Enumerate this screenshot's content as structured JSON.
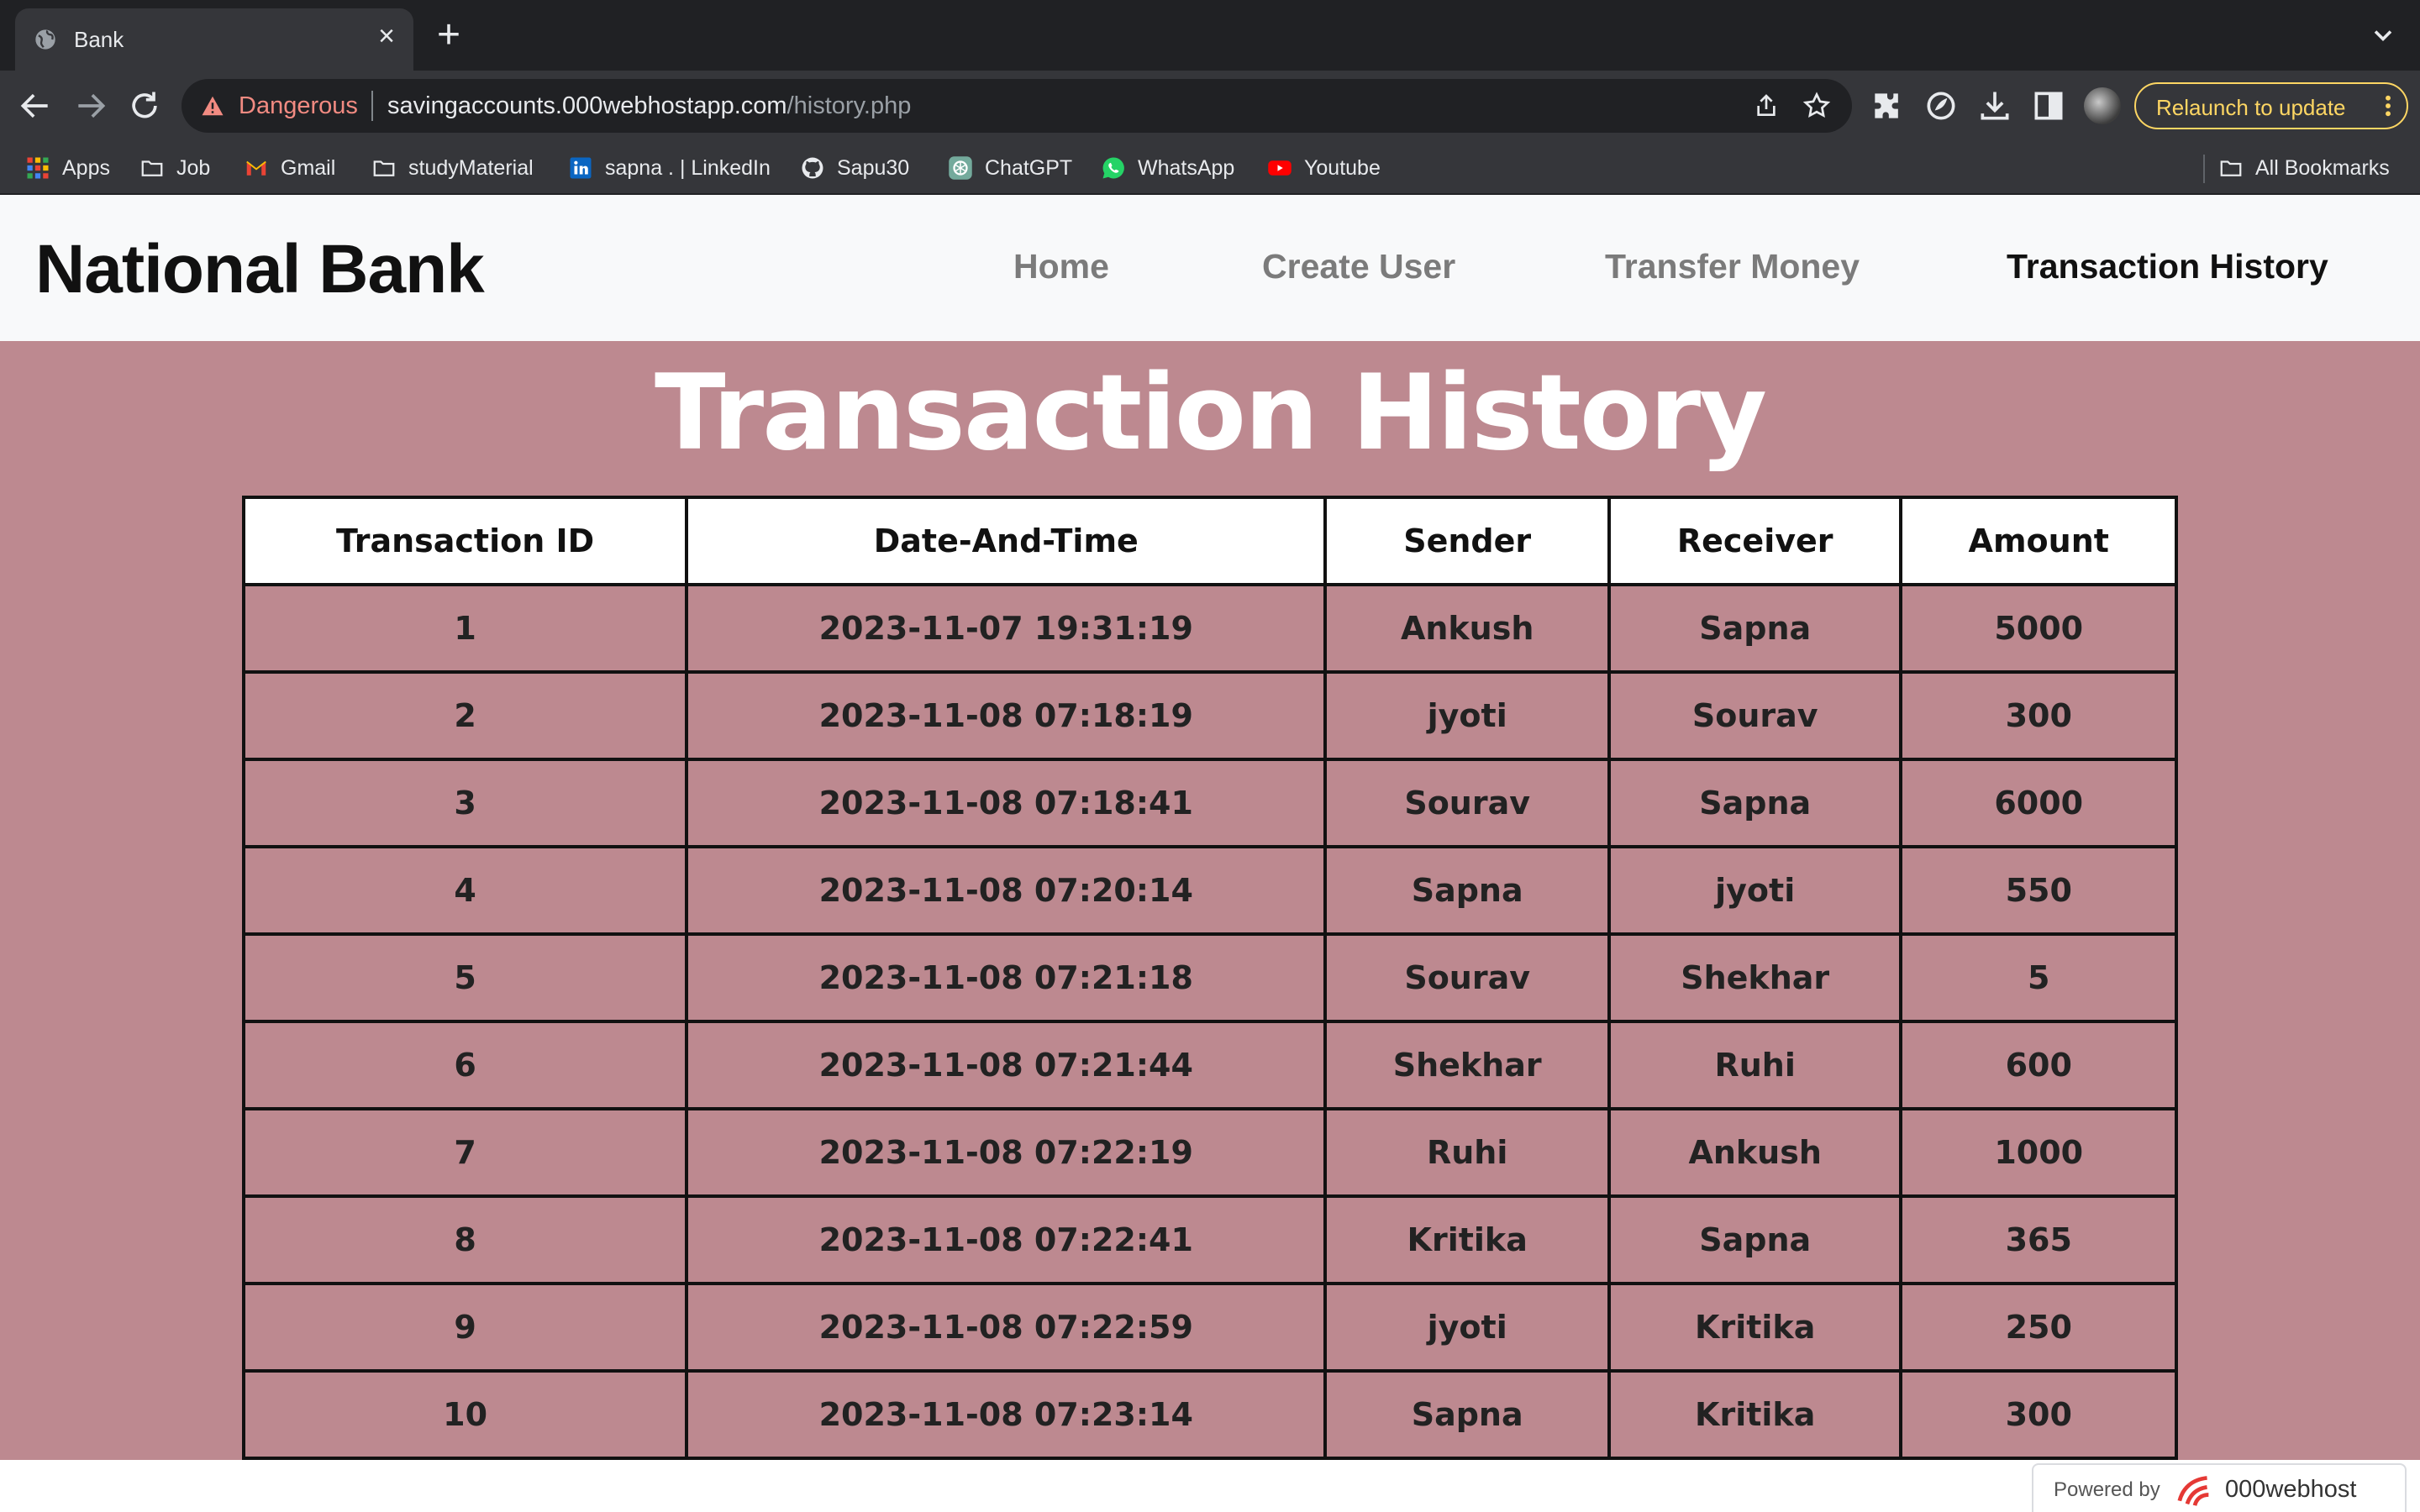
{
  "browser": {
    "tab_title": "Bank",
    "omnibox": {
      "security_label": "Dangerous",
      "url_host": "savingaccounts.000webhostapp.com",
      "url_path": "/history.php"
    },
    "relaunch_label": "Relaunch to update",
    "bookmarks": [
      {
        "label": "Apps",
        "icon": "apps-grid-icon"
      },
      {
        "label": "Job",
        "icon": "folder-icon"
      },
      {
        "label": "Gmail",
        "icon": "gmail-icon"
      },
      {
        "label": "studyMaterial",
        "icon": "folder-icon"
      },
      {
        "label": "sapna . | LinkedIn",
        "icon": "linkedin-icon"
      },
      {
        "label": "Sapu30",
        "icon": "github-icon"
      },
      {
        "label": "ChatGPT",
        "icon": "chatgpt-icon"
      },
      {
        "label": "WhatsApp",
        "icon": "whatsapp-icon"
      },
      {
        "label": "Youtube",
        "icon": "youtube-icon"
      }
    ],
    "all_bookmarks_label": "All Bookmarks"
  },
  "navbar": {
    "brand": "National Bank",
    "links": [
      {
        "label": "Home",
        "active": false
      },
      {
        "label": "Create User",
        "active": false
      },
      {
        "label": "Transfer Money",
        "active": false
      },
      {
        "label": "Transaction History",
        "active": true
      }
    ]
  },
  "page": {
    "heading": "Transaction History",
    "background_color": "#bd8990"
  },
  "table": {
    "columns": [
      "Transaction ID",
      "Date-And-Time",
      "Sender",
      "Receiver",
      "Amount"
    ],
    "rows": [
      [
        "1",
        "2023-11-07 19:31:19",
        "Ankush",
        "Sapna",
        "5000"
      ],
      [
        "2",
        "2023-11-08 07:18:19",
        "jyoti",
        "Sourav",
        "300"
      ],
      [
        "3",
        "2023-11-08 07:18:41",
        "Sourav",
        "Sapna",
        "6000"
      ],
      [
        "4",
        "2023-11-08 07:20:14",
        "Sapna",
        "jyoti",
        "550"
      ],
      [
        "5",
        "2023-11-08 07:21:18",
        "Sourav",
        "Shekhar",
        "5"
      ],
      [
        "6",
        "2023-11-08 07:21:44",
        "Shekhar",
        "Ruhi",
        "600"
      ],
      [
        "7",
        "2023-11-08 07:22:19",
        "Ruhi",
        "Ankush",
        "1000"
      ],
      [
        "8",
        "2023-11-08 07:22:41",
        "Kritika",
        "Sapna",
        "365"
      ],
      [
        "9",
        "2023-11-08 07:22:59",
        "jyoti",
        "Kritika",
        "250"
      ],
      [
        "10",
        "2023-11-08 07:23:14",
        "Sapna",
        "Kritika",
        "300"
      ]
    ]
  },
  "footer": {
    "powered_by": "Powered by",
    "host_name": "000webhost"
  }
}
